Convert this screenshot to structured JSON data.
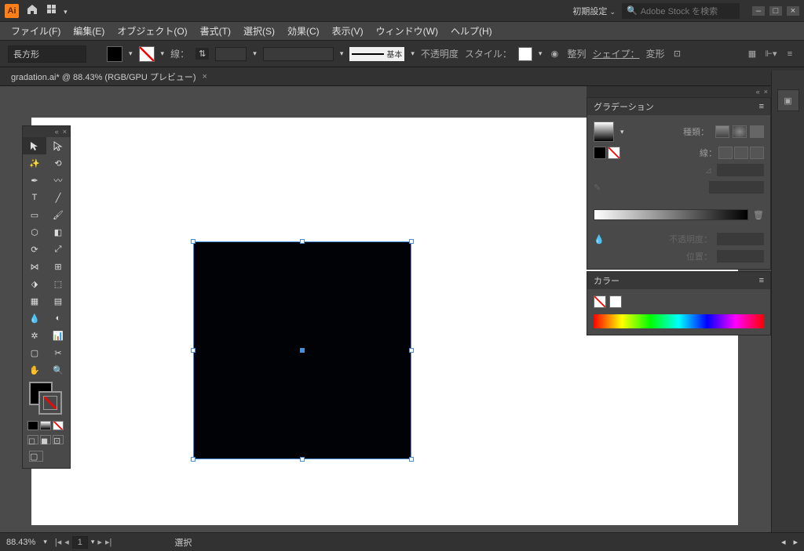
{
  "app": {
    "logo": "Ai",
    "workspace": "初期設定",
    "search_placeholder": "Adobe Stock を検索"
  },
  "menu": {
    "file": "ファイル(F)",
    "edit": "編集(E)",
    "object": "オブジェクト(O)",
    "type": "書式(T)",
    "select": "選択(S)",
    "effect": "効果(C)",
    "view": "表示(V)",
    "window": "ウィンドウ(W)",
    "help": "ヘルプ(H)"
  },
  "options": {
    "shape": "長方形",
    "stroke_label": "線：",
    "stroke_style_label": "基本",
    "opacity_label": "不透明度",
    "style_label": "スタイル：",
    "align_label": "整列",
    "shape_btn": "シェイプ：",
    "transform_label": "変形"
  },
  "doc": {
    "tab": "gradation.ai* @ 88.43% (RGB/GPU プレビュー)"
  },
  "panel": {
    "gradient": {
      "title": "グラデーション",
      "type_label": "種類：",
      "stroke_label": "線：",
      "angle_label": "⊿",
      "opacity_label": "不透明度：",
      "location_label": "位置："
    },
    "color": {
      "title": "カラー"
    }
  },
  "status": {
    "zoom": "88.43%",
    "artboard": "1",
    "tool": "選択"
  }
}
